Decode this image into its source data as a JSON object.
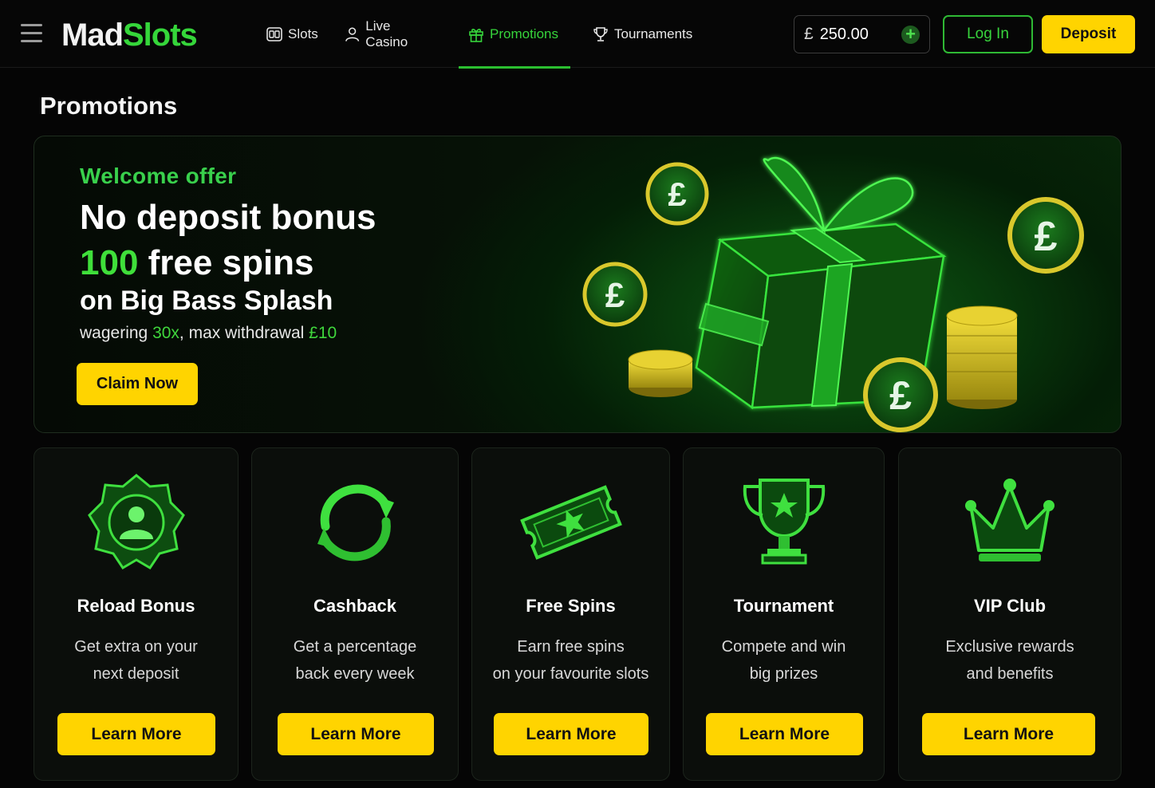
{
  "header": {
    "logo_part1": "Mad",
    "logo_part2": "Slots",
    "nav": [
      {
        "label": "Slots",
        "icon": "slot-machine-icon"
      },
      {
        "label": "Live Casino",
        "icon": "user-icon"
      },
      {
        "label": "Promotions",
        "icon": "gift-icon",
        "active": true
      },
      {
        "label": "Tournaments",
        "icon": "trophy-icon"
      }
    ],
    "balance": {
      "currency": "£",
      "amount": "250.00"
    },
    "login_label": "Log In",
    "deposit_label": "Deposit"
  },
  "page_title": "Promotions",
  "hero": {
    "eyebrow": "Welcome offer",
    "line1": "No deposit bonus",
    "spins_count": "100",
    "spins_text": "free spins",
    "line3": "on Big Bass Splash",
    "terms_prefix": "wagering ",
    "wagering": "30x",
    "terms_mid": ", max withdrawal ",
    "max_withdrawal": "£10",
    "cta": "Claim Now"
  },
  "cards": [
    {
      "title": "Reload Bonus",
      "desc1": "Get extra on your",
      "desc2": "next deposit",
      "cta": "Learn More",
      "icon": "reload-badge-icon"
    },
    {
      "title": "Cashback",
      "desc1": "Get a percentage",
      "desc2": "back every week",
      "cta": "Learn More",
      "icon": "cashback-arrows-icon"
    },
    {
      "title": "Free Spins",
      "desc1": "Earn free spins",
      "desc2": "on your favourite slots",
      "cta": "Learn More",
      "icon": "ticket-star-icon"
    },
    {
      "title": "Tournament",
      "desc1": "Compete and win",
      "desc2": "big prizes",
      "cta": "Learn More",
      "icon": "trophy-star-icon"
    },
    {
      "title": "VIP Club",
      "desc1": "Exclusive rewards",
      "desc2": "and benefits",
      "cta": "Learn More",
      "icon": "crown-icon"
    }
  ],
  "colors": {
    "accent_green": "#35d63a",
    "cta_yellow": "#ffd400",
    "background": "#050505"
  }
}
